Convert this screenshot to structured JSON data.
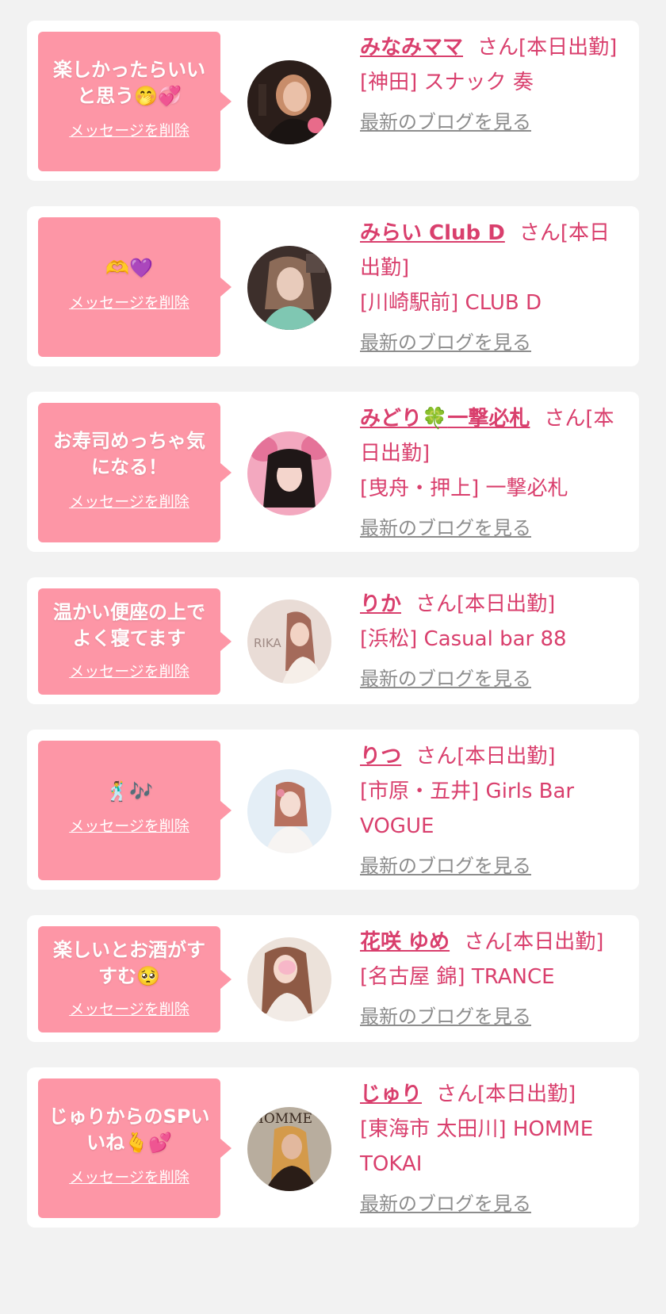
{
  "cards": [
    {
      "message": "楽しかったらいいと思う",
      "message_emoji": "🤭💞",
      "delete_label": "メッセージを削除",
      "name": "みなみママ",
      "suffix": "さん[本日出勤]",
      "shop": "[神田] スナック 奏",
      "blog_label": "最新のブログを見る",
      "avatar_colors": [
        "#2b1e1a",
        "#e8b9a8"
      ]
    },
    {
      "message": "",
      "message_emoji": "🫶💜",
      "delete_label": "メッセージを削除",
      "name": "みらい Club D",
      "suffix": "さん[本日出勤]",
      "shop": "[川崎駅前] CLUB D",
      "blog_label": "最新のブログを見る",
      "avatar_colors": [
        "#4b3a35",
        "#d9c0b2"
      ]
    },
    {
      "message": "お寿司めっちゃ気になる！",
      "message_emoji": "",
      "delete_label": "メッセージを削除",
      "name_before": "みどり",
      "name_emoji": "🍀",
      "name_after": "一撃必札",
      "suffix": "さん[本日出勤]",
      "shop": "[曳舟・押上] 一撃必札",
      "blog_label": "最新のブログを見る",
      "avatar_colors": [
        "#f3a8bf",
        "#2a1e1e"
      ]
    },
    {
      "message": "温かい便座の上でよく寝てます",
      "message_emoji": "",
      "delete_label": "メッセージを削除",
      "name": "りか",
      "suffix": "さん[本日出勤]",
      "shop": "[浜松] Casual bar 88",
      "blog_label": "最新のブログを見る",
      "avatar_text": "RIKA",
      "avatar_colors": [
        "#e9dcd6",
        "#a46a5a"
      ]
    },
    {
      "message": "",
      "message_emoji": "🕺🎶",
      "delete_label": "メッセージを削除",
      "name": "りつ",
      "suffix": "さん[本日出勤]",
      "shop": "[市原・五井] Girls Bar VOGUE",
      "blog_label": "最新のブログを見る",
      "avatar_colors": [
        "#e4eef6",
        "#b8715f"
      ]
    },
    {
      "message": "楽しいとお酒がすすむ",
      "message_emoji": "🥺",
      "delete_label": "メッセージを削除",
      "name": "花咲 ゆめ",
      "suffix": "さん[本日出勤]",
      "shop": "[名古屋 錦] TRANCE",
      "blog_label": "最新のブログを見る",
      "avatar_colors": [
        "#ece2da",
        "#8e5a45"
      ]
    },
    {
      "message": "じゅりからのSPいいね",
      "message_emoji": "🫰💕",
      "delete_label": "メッセージを削除",
      "name": "じゅり",
      "suffix": "さん[本日出勤]",
      "shop": "[東海市 太田川] HOMME TOKAI",
      "blog_label": "最新のブログを見る",
      "avatar_text": "HOMME",
      "avatar_colors": [
        "#b8ad9e",
        "#3a2a20"
      ]
    }
  ],
  "colors": {
    "accent": "#d93f6d",
    "bubble": "#fd96a6",
    "link_gray": "#8d8d8d",
    "background": "#f2f2f2"
  }
}
